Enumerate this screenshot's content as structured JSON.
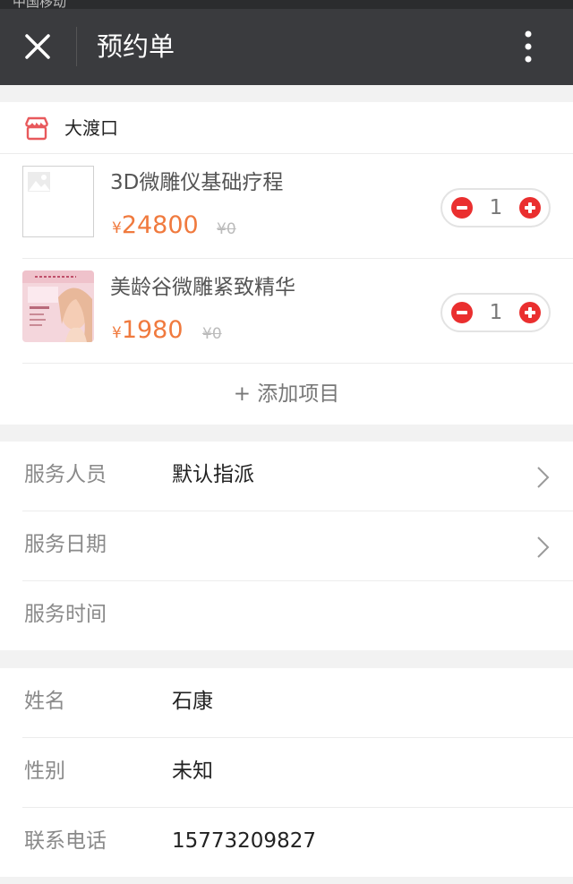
{
  "status_bar": {
    "carrier": "中国移动"
  },
  "navbar": {
    "title": "预约单",
    "close_icon": "close-icon",
    "more_icon": "more-vertical-icon"
  },
  "store": {
    "name": "大渡口",
    "icon": "storefront-icon",
    "items": [
      {
        "name": "3D微雕仪基础疗程",
        "currency": "¥",
        "price": "24800",
        "original_price": "¥0",
        "quantity": "1",
        "thumbnail": "image-placeholder-icon"
      },
      {
        "name": "美龄谷微雕紧致精华",
        "currency": "¥",
        "price": "1980",
        "original_price": "¥0",
        "quantity": "1",
        "thumbnail": "product-photo"
      }
    ],
    "add_item_label": "+ 添加项目"
  },
  "service": {
    "staff_label": "服务人员",
    "staff_value": "默认指派",
    "date_label": "服务日期",
    "date_value": "",
    "time_label": "服务时间",
    "time_value": ""
  },
  "contact": {
    "name_label": "姓名",
    "name_value": "石康",
    "gender_label": "性别",
    "gender_value": "未知",
    "phone_label": "联系电话",
    "phone_value": "15773209827"
  },
  "colors": {
    "accent": "#f07a3e",
    "stepper": "#ea2f2f",
    "navbar": "#3a3b3e",
    "store_icon": "#e8595c"
  }
}
